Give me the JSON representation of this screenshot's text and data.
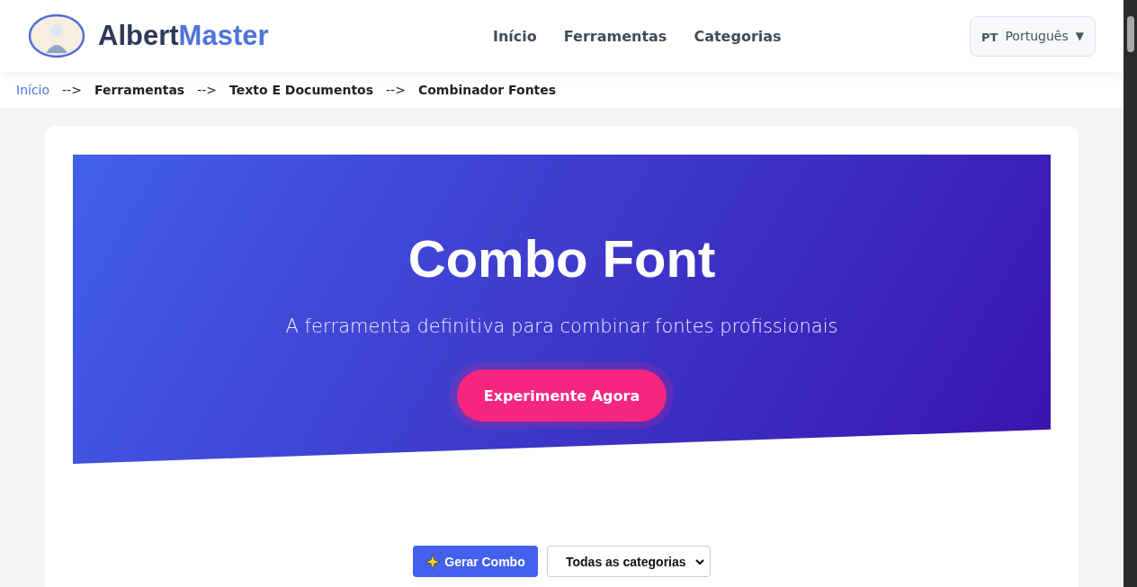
{
  "header": {
    "brand": {
      "first": "Albert",
      "second": "Master"
    },
    "nav": [
      "Início",
      "Ferramentas",
      "Categorias"
    ],
    "language": {
      "code": "PT",
      "label": "Português",
      "caret": "▼"
    }
  },
  "breadcrumb": [
    {
      "kind": "link",
      "text": "Início"
    },
    {
      "kind": "separator",
      "text": "-->"
    },
    {
      "kind": "page",
      "text": "Ferramentas"
    },
    {
      "kind": "separator",
      "text": "-->"
    },
    {
      "kind": "page",
      "text": "Texto E Documentos"
    },
    {
      "kind": "separator",
      "text": "-->"
    },
    {
      "kind": "page",
      "text": "Combinador Fontes"
    }
  ],
  "hero": {
    "title": "Combo Font",
    "subtitle": "A ferramenta definitiva para combinar fontes profissionais",
    "cta": "Experimente Agora"
  },
  "controls": {
    "generate": "Gerar Combo",
    "category": "Todas as categorias"
  }
}
